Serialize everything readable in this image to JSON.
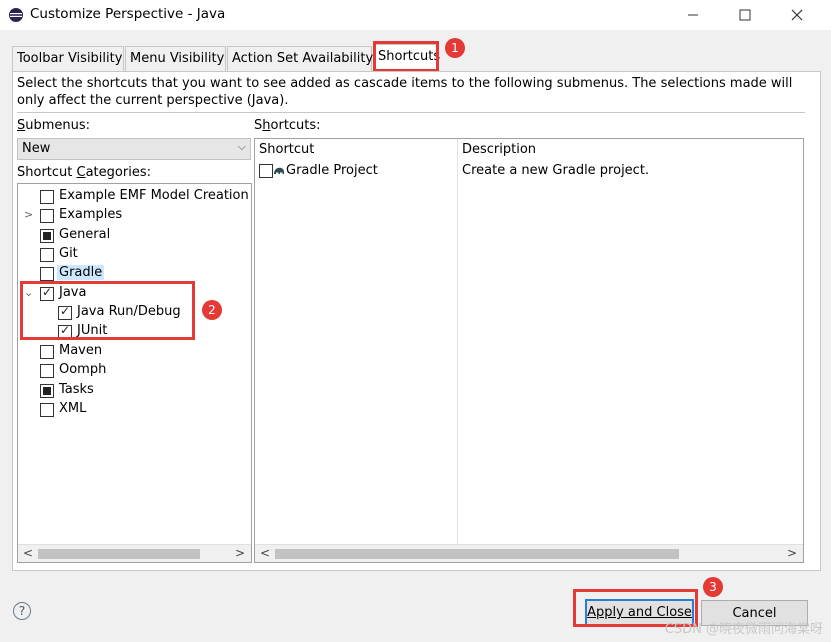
{
  "window": {
    "title": "Customize Perspective - Java"
  },
  "tabs": [
    {
      "label": "Toolbar Visibility"
    },
    {
      "label": "Menu Visibility"
    },
    {
      "label": "Action Set Availability"
    },
    {
      "label": "Shortcuts"
    }
  ],
  "description": "Select the shortcuts that you want to see added as cascade items to the following submenus.  The selections made will only affect the current perspective (Java).",
  "submenus": {
    "label": "Submenus:",
    "selected": "New"
  },
  "categories": {
    "label": "Shortcut Categories:",
    "items": [
      {
        "label": "Example EMF Model Creation W"
      },
      {
        "label": "Examples"
      },
      {
        "label": "General"
      },
      {
        "label": "Git"
      },
      {
        "label": "Gradle"
      },
      {
        "label": "Java"
      },
      {
        "label": "Java Run/Debug"
      },
      {
        "label": "JUnit"
      },
      {
        "label": "Maven"
      },
      {
        "label": "Oomph"
      },
      {
        "label": "Tasks"
      },
      {
        "label": "XML"
      }
    ]
  },
  "shortcuts": {
    "label": "Shortcuts:",
    "columns": [
      "Shortcut",
      "Description"
    ],
    "rows": [
      {
        "name": "Gradle Project",
        "description": "Create a new Gradle project."
      }
    ]
  },
  "buttons": {
    "apply_close": "Apply and Close",
    "cancel": "Cancel"
  },
  "annotations": [
    "1",
    "2",
    "3"
  ],
  "watermark": "CSDN @晓夜微雨问海棠呀",
  "colors": {
    "annotation_red": "#e53935",
    "selection_blue": "#cce8ff"
  }
}
